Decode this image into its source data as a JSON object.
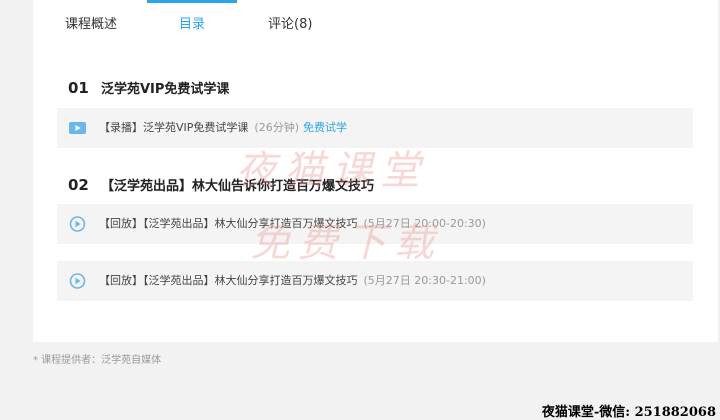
{
  "tabs": [
    {
      "label": "课程概述"
    },
    {
      "label": "目录"
    },
    {
      "label": "评论(8)"
    }
  ],
  "colors": {
    "accent": "#2aa5ec"
  },
  "sections": [
    {
      "number": "01",
      "title": "泛学苑VIP免费试学课",
      "lessons": [
        {
          "icon": "video-icon",
          "text": "【录播】泛学苑VIP免费试学课",
          "meta": "(26分钟)",
          "trial": "免费试学"
        }
      ]
    },
    {
      "number": "02",
      "title": "【泛学苑出品】林大仙告诉你打造百万爆文技巧",
      "lessons": [
        {
          "icon": "replay-icon",
          "text": "【回放】【泛学苑出品】林大仙分享打造百万爆文技巧",
          "meta": "(5月27日 20:00-20:30)"
        },
        {
          "icon": "replay-icon",
          "text": "【回放】【泛学苑出品】林大仙分享打造百万爆文技巧",
          "meta": "(5月27日 20:30-21:00)"
        }
      ]
    }
  ],
  "watermark": {
    "line1": "夜猫课堂",
    "line2": "免费下载"
  },
  "provider": "* 课程提供者：泛学苑自媒体",
  "footer": "夜猫课堂-微信: 251882068"
}
